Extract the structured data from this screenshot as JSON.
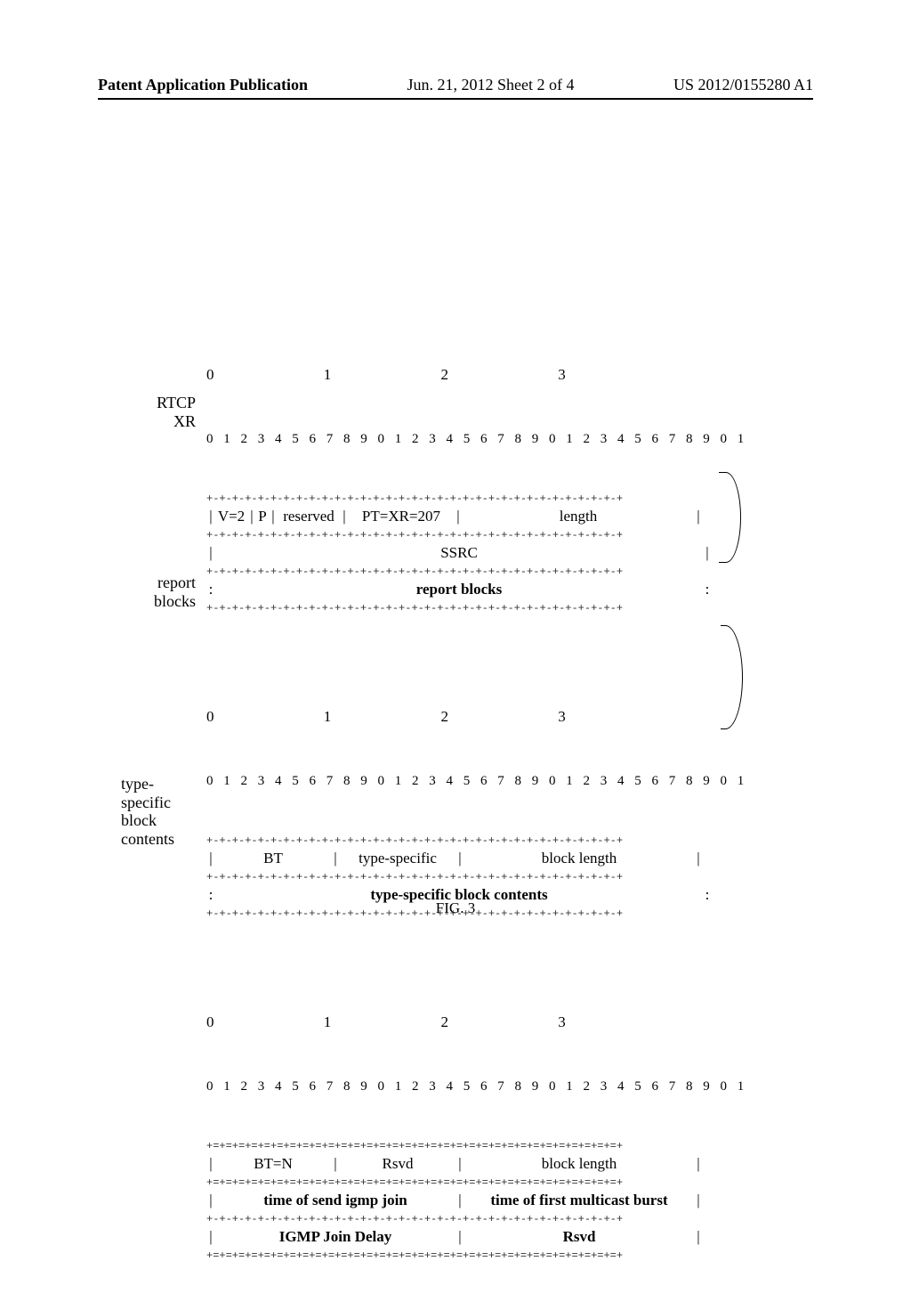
{
  "header": {
    "left": "Patent Application Publication",
    "center": "Jun. 21, 2012  Sheet 2 of 4",
    "right": "US 2012/0155280 A1"
  },
  "labels": {
    "rtcp_xr": "RTCP\nXR",
    "report_blocks_side": "report\nblocks",
    "type_specific_block_contents_side": "type-\nspecific\nblock\ncontents"
  },
  "bytescale": {
    "top": "0                             1                             2                             3",
    "bits": "0 1 2 3 4 5 6 7 8 9 0 1 2 3 4 5 6 7 8 9 0 1 2 3 4 5 6 7 8 9 0 1"
  },
  "border_eqpl": "+=+=+=+=+=+=+=+=+=+=+=+=+=+=+=+=+=+=+=+=+=+=+=+=+=+=+=+=+=+=+=+=+",
  "border_dash": "+-+-+-+-+-+-+-+-+-+-+-+-+-+-+-+-+-+-+-+-+-+-+-+-+-+-+-+-+-+-+-+-+",
  "block1": {
    "r1c1": "V=2",
    "r1c2": "P",
    "r1c3": "reserved",
    "r1c4": "PT=XR=207",
    "r1c5": "length",
    "r2": "SSRC",
    "r3": "report blocks"
  },
  "block2": {
    "r1c1": "BT",
    "r1c2": "type-specific",
    "r1c3": "block length",
    "r2": "type-specific block contents"
  },
  "block3": {
    "r1c1": "BT=N",
    "r1c2": "Rsvd",
    "r1c3": "block length",
    "r2c1": "time of send igmp join",
    "r2c2": "time of first multicast burst",
    "r3c1": "IGMP Join Delay",
    "r3c2": "Rsvd"
  },
  "caption": "FIG. 3"
}
